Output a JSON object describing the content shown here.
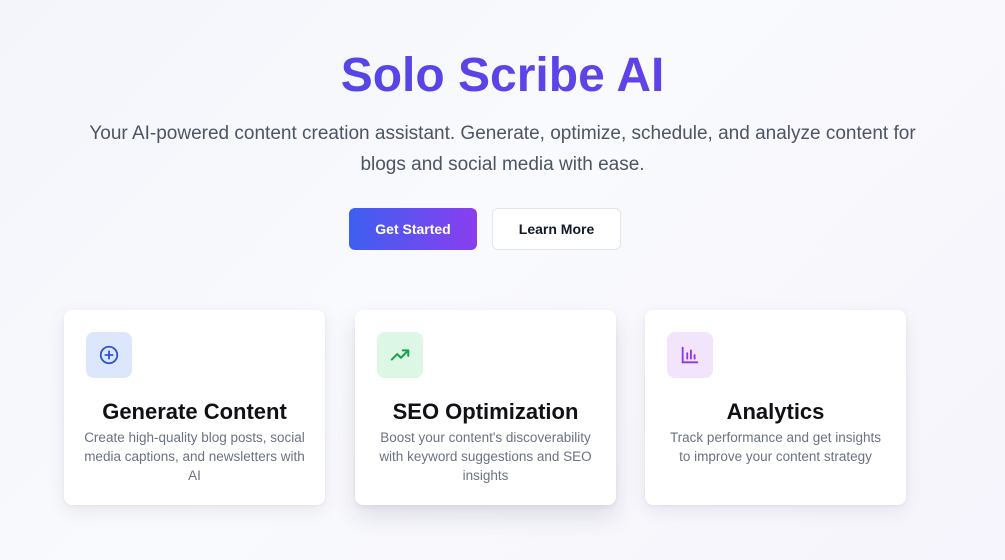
{
  "hero": {
    "title": "Solo Scribe AI",
    "subtitle": "Your AI-powered content creation assistant. Generate, optimize, schedule, and analyze content for blogs and social media with ease.",
    "primary_button": "Get Started",
    "secondary_button": "Learn More"
  },
  "features": [
    {
      "title": "Generate Content",
      "description": "Create high-quality blog posts, social media captions, and newsletters with AI",
      "icon": "plus-circle-icon",
      "icon_color": "#2f55d4",
      "icon_bg": "#dde7fb"
    },
    {
      "title": "SEO Optimization",
      "description": "Boost your content's discoverability with keyword suggestions and SEO insights",
      "icon": "trending-up-icon",
      "icon_color": "#16a34a",
      "icon_bg": "#dcf7e6"
    },
    {
      "title": "Analytics",
      "description": "Track performance and get insights to improve your content strategy",
      "icon": "bar-chart-icon",
      "icon_color": "#9333ea",
      "icon_bg": "#f1e4fb"
    }
  ],
  "colors": {
    "accent_start": "#3e5ff0",
    "accent_end": "#8a3ef0",
    "title": "#5b3fe0"
  }
}
